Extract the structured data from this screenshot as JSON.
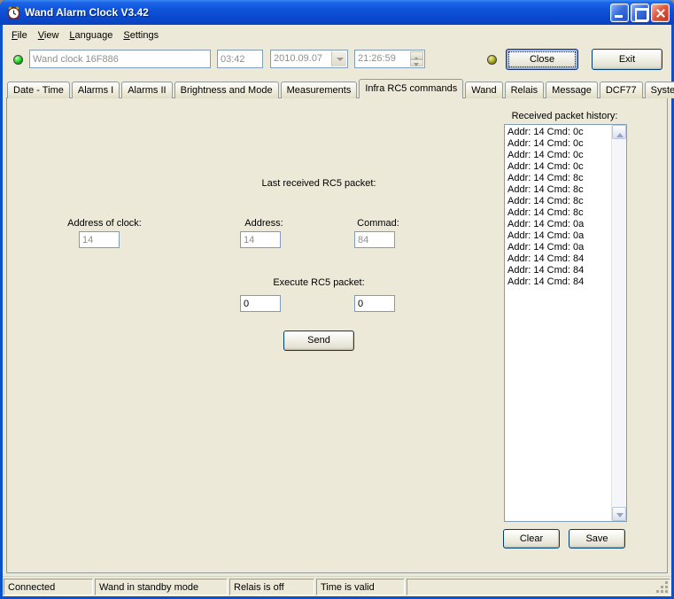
{
  "window": {
    "title": "Wand Alarm Clock V3.42"
  },
  "menu": {
    "items": [
      "File",
      "View",
      "Language",
      "Settings"
    ]
  },
  "toolbar": {
    "device_field": "Wand clock 16F886",
    "alarm_time_field": "03:42",
    "date_field": "2010.09.07",
    "time_field": "21:26:59",
    "close_button": "Close",
    "exit_button": "Exit"
  },
  "tabs": [
    "Date - Time",
    "Alarms I",
    "Alarms II",
    "Brightness and Mode",
    "Measurements",
    "Infra RC5 commands",
    "Wand",
    "Relais",
    "Message",
    "DCF77",
    "System"
  ],
  "active_tab": "Infra RC5 commands",
  "rc5_panel": {
    "history_label": "Received packet history:",
    "history": [
      "Addr: 14 Cmd: 0c",
      "Addr: 14 Cmd: 0c",
      "Addr: 14 Cmd: 0c",
      "Addr: 14 Cmd: 0c",
      "Addr: 14 Cmd: 8c",
      "Addr: 14 Cmd: 8c",
      "Addr: 14 Cmd: 8c",
      "Addr: 14 Cmd: 8c",
      "Addr: 14 Cmd: 0a",
      "Addr: 14 Cmd: 0a",
      "Addr: 14 Cmd: 0a",
      "Addr: 14 Cmd: 84",
      "Addr: 14 Cmd: 84",
      "Addr: 14 Cmd: 84"
    ],
    "last_received_label": "Last received RC5 packet:",
    "address_of_clock_label": "Address of clock:",
    "address_of_clock_value": "14",
    "address_label": "Address:",
    "address_value": "14",
    "command_label": "Commad:",
    "command_value": "84",
    "execute_label": "Execute RC5 packet:",
    "execute_address_value": "0",
    "execute_command_value": "0",
    "send_button": "Send",
    "clear_button": "Clear",
    "save_button": "Save"
  },
  "statusbar": {
    "panels": [
      "Connected",
      "Wand in standby mode",
      "Relais is off",
      "Time is valid"
    ]
  },
  "colors": {
    "titlebar_blue": "#0F55DC",
    "face": "#ECE9D8",
    "led_connected_green": "#00A000",
    "led_secondary_olive": "#8A8A00"
  }
}
